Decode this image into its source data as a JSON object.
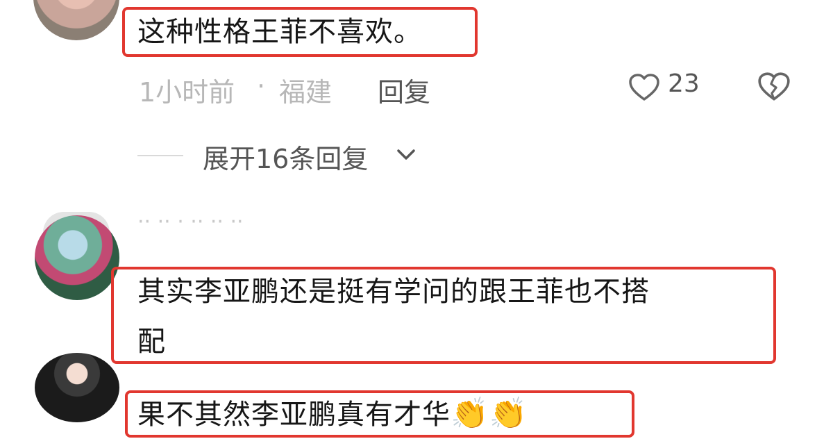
{
  "comments": [
    {
      "text": "这种性格王菲不喜欢。",
      "time": "1小时前",
      "separator": "·",
      "location": "福建",
      "reply_label": "回复",
      "like_count": "23",
      "expand_label": "展开16条回复"
    },
    {
      "faded_name": "·· ·· · ·· ·· ··"
    },
    {
      "text_line1": "其实李亚鹏还是挺有学问的跟王菲也不搭",
      "text_line2": "配"
    },
    {
      "text": "果不其然李亚鹏真有才华",
      "emoji": "👏👏"
    }
  ],
  "colors": {
    "highlight_border": "#e1372f",
    "meta_text": "#b7b7b7",
    "action_text": "#555555"
  }
}
